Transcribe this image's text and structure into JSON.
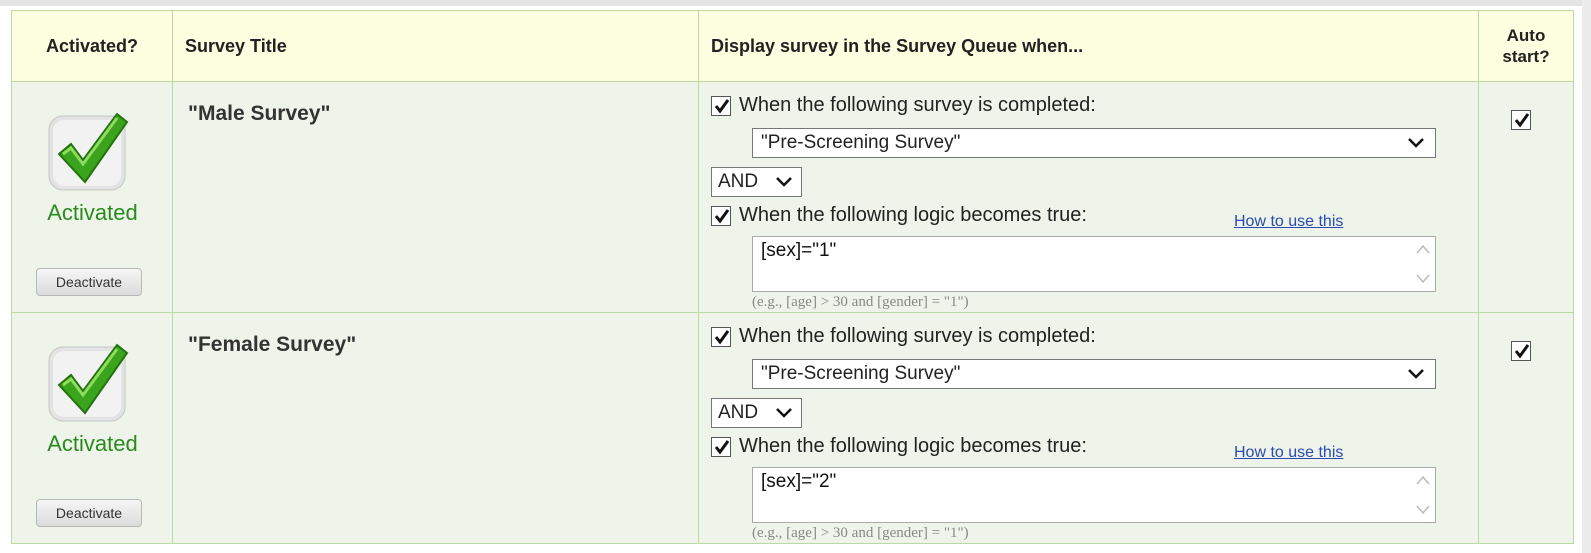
{
  "headers": {
    "activated": "Activated?",
    "title": "Survey Title",
    "display": "Display survey in the Survey Queue when...",
    "autostart": "Auto start?"
  },
  "rows": [
    {
      "title": "\"Male Survey\"",
      "status": "Activated",
      "deactivate_label": "Deactivate",
      "survey_completed_checked": true,
      "survey_completed_label": "When the following survey is completed:",
      "survey_select_value": "\"Pre-Screening Survey\"",
      "operator_value": "AND",
      "logic_checked": true,
      "logic_label": "When the following logic becomes true:",
      "howto_link": "How to use this",
      "logic_value": "[sex]=\"1\"",
      "logic_hint": "(e.g., [age] > 30 and [gender] = \"1\")",
      "auto_start_checked": true
    },
    {
      "title": "\"Female Survey\"",
      "status": "Activated",
      "deactivate_label": "Deactivate",
      "survey_completed_checked": true,
      "survey_completed_label": "When the following survey is completed:",
      "survey_select_value": "\"Pre-Screening Survey\"",
      "operator_value": "AND",
      "logic_checked": true,
      "logic_label": "When the following logic becomes true:",
      "howto_link": "How to use this",
      "logic_value": "[sex]=\"2\"",
      "logic_hint": "(e.g., [age] > 30 and [gender] = \"1\")",
      "auto_start_checked": true
    }
  ],
  "colors": {
    "header_bg": "#fefee0",
    "row_bg": "#eef4e9",
    "border": "#b9dba0",
    "activated_text": "#2a8a1f",
    "link": "#2a4cb0"
  }
}
